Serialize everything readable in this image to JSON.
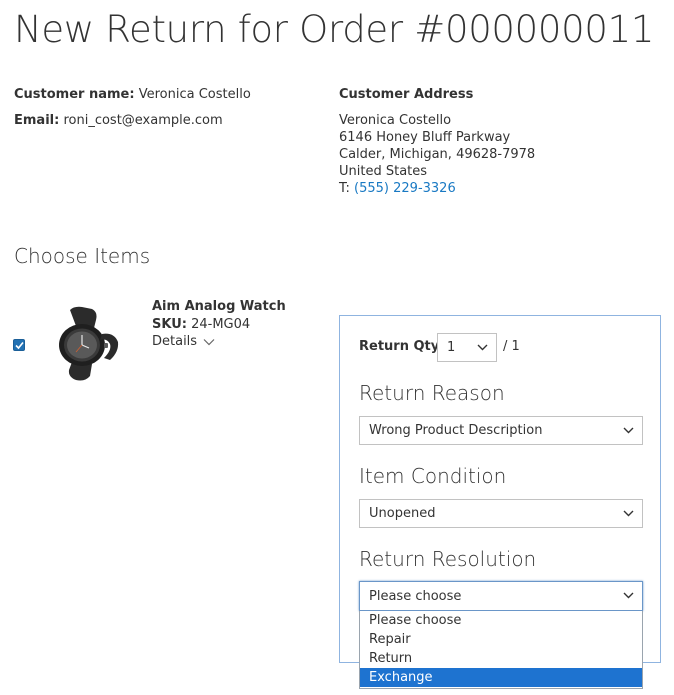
{
  "page": {
    "title": "New Return for Order #000000011"
  },
  "customer": {
    "name_label": "Customer name:",
    "name": "Veronica Costello",
    "email_label": "Email:",
    "email": "roni_cost@example.com"
  },
  "address": {
    "title": "Customer Address",
    "lines": [
      "Veronica Costello",
      "6146 Honey Bluff Parkway",
      "Calder, Michigan, 49628-7978",
      "United States"
    ],
    "phone_prefix": "T:",
    "phone": "(555) 229-3326"
  },
  "items_section": {
    "title": "Choose Items"
  },
  "item": {
    "checked": true,
    "name": "Aim Analog Watch",
    "sku_label": "SKU:",
    "sku": "24-MG04",
    "details_label": "Details",
    "image_icon": "watch-image"
  },
  "return_form": {
    "qty_label": "Return Qty",
    "qty_value": "1",
    "qty_max": "/ 1",
    "reason_title": "Return Reason",
    "reason_value": "Wrong Product Description",
    "condition_title": "Item Condition",
    "condition_value": "Unopened",
    "resolution_title": "Return Resolution",
    "resolution_value": "Please choose",
    "resolution_options": [
      "Please choose",
      "Repair",
      "Return",
      "Exchange"
    ],
    "resolution_highlighted": "Exchange"
  },
  "colors": {
    "link": "#1979c3",
    "highlight": "#1e73d0",
    "checkbox": "#2271b3",
    "panel_border": "#8fb4e0"
  }
}
